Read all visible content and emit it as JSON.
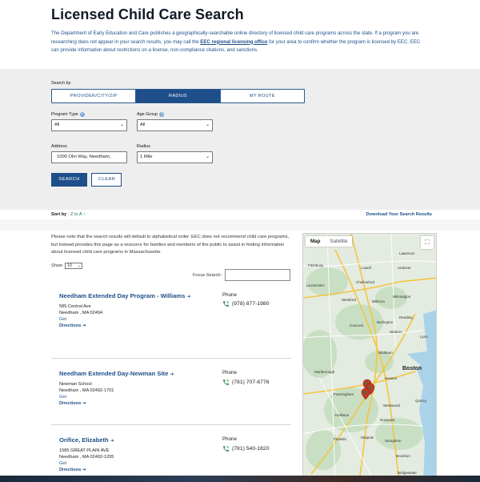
{
  "page": {
    "title": "Licensed Child Care Search",
    "intro_part1": "The Department of Early Education and Care publishes a geographically-searchable online directory of licensed child care programs across the state. If a program you are researching does not appear in your search results, you may call the ",
    "intro_link": "EEC regional licensing office",
    "intro_part2": " for your area to confirm whether the program is licensed by EEC. EEC can provide information about restrictions on a license, non-compliance citations, and sanctions."
  },
  "search": {
    "search_by_label": "Search by",
    "tabs": [
      {
        "label": "PROVIDER/CITY/ZIP",
        "active": false
      },
      {
        "label": "RADIUS",
        "active": true
      },
      {
        "label": "MY ROUTE",
        "active": false
      }
    ],
    "program_type_label": "Program Type",
    "program_type_value": "All",
    "age_group_label": "Age Group",
    "age_group_value": "All",
    "address_label": "Address",
    "address_value": "1000 Olin Way, Needham,",
    "radius_label": "Radius",
    "radius_value": "1 Mile",
    "search_button": "SEARCH",
    "clear_button": "CLEAR"
  },
  "sort": {
    "label": "Sort by",
    "value": ": Z to A",
    "arrow": "↑",
    "download_link": "Download Your Search Results"
  },
  "results": {
    "note": "Please note that the search results will default to alphabetical order. EEC does not recommend child care programs, but instead provides this page as a resource for families and members of the public to assist in finding information about licensed child care programs in Massachusetts.",
    "show_label": "Show",
    "show_value": "10",
    "focus_label": "Focus Search:",
    "phone_label": "Phone",
    "get_label": "Get",
    "directions_label": "Directions",
    "items": [
      {
        "name": "Needham Extended Day Program - Williams",
        "line1": "585 Central Ave",
        "line2": "Needham , MA 02494",
        "line3": "",
        "phone": "(978) 877-1980"
      },
      {
        "name": "Needham Extended Day-Newman Site",
        "line1": "Newman School",
        "line2": "Needham , MA 02492-1701",
        "line3": "",
        "phone": "(781) 707-6776"
      },
      {
        "name": "Orifice, Elizabeth",
        "line1": "1585 GREAT PLAIN AVE",
        "line2": "Needham , MA 02492-1205",
        "line3": "",
        "phone": "(781) 540-1820"
      }
    ]
  },
  "map": {
    "tab_map": "Map",
    "tab_satellite": "Satellite",
    "fullscreen_icon": "fullscreen-icon",
    "cities": [
      {
        "name": "Fitchburg",
        "big": false
      },
      {
        "name": "Lowell",
        "big": false
      },
      {
        "name": "Lawrence",
        "big": false
      },
      {
        "name": "Leominster",
        "big": false
      },
      {
        "name": "Chelmsford",
        "big": false
      },
      {
        "name": "Andover",
        "big": false
      },
      {
        "name": "Westford",
        "big": false
      },
      {
        "name": "Billerica",
        "big": false
      },
      {
        "name": "Wilmington",
        "big": false
      },
      {
        "name": "Reading",
        "big": false
      },
      {
        "name": "Lynn",
        "big": false
      },
      {
        "name": "Concord",
        "big": false
      },
      {
        "name": "Burlington",
        "big": false
      },
      {
        "name": "Woburn",
        "big": false
      },
      {
        "name": "Marlborough",
        "big": false
      },
      {
        "name": "Waltham",
        "big": false
      },
      {
        "name": "Boston",
        "big": true
      },
      {
        "name": "Framingham",
        "big": false
      },
      {
        "name": "Newton",
        "big": false
      },
      {
        "name": "Quincy",
        "big": false
      },
      {
        "name": "Holliston",
        "big": false
      },
      {
        "name": "Westwood",
        "big": false
      },
      {
        "name": "Norwood",
        "big": false
      },
      {
        "name": "Franklin",
        "big": false
      },
      {
        "name": "Walpole",
        "big": false
      },
      {
        "name": "Brockton",
        "big": false
      },
      {
        "name": "Stoughton",
        "big": false
      },
      {
        "name": "Bridgewater",
        "big": false
      }
    ]
  }
}
